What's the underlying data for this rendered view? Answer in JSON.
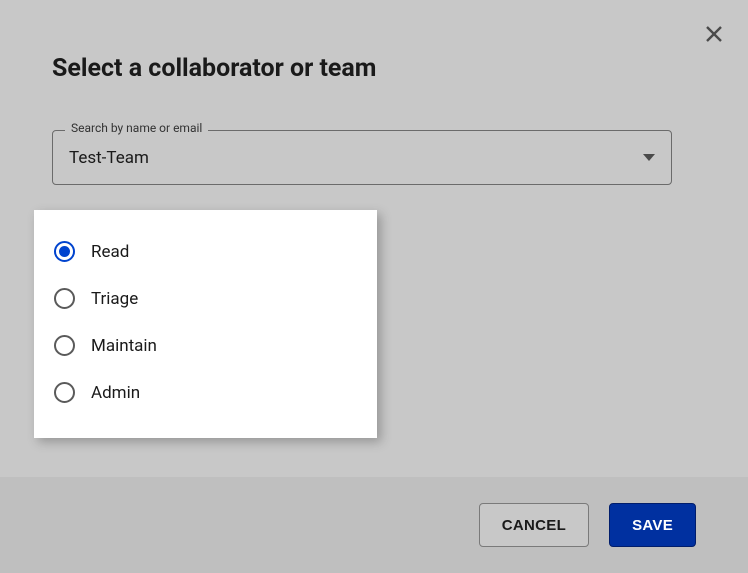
{
  "dialog": {
    "title": "Select a collaborator or team"
  },
  "search": {
    "label": "Search by name or email",
    "value": "Test-Team"
  },
  "permissions": {
    "selected_index": 0,
    "options": [
      {
        "label": "Read"
      },
      {
        "label": "Triage"
      },
      {
        "label": "Maintain"
      },
      {
        "label": "Admin"
      }
    ]
  },
  "buttons": {
    "cancel": "CANCEL",
    "save": "SAVE"
  }
}
